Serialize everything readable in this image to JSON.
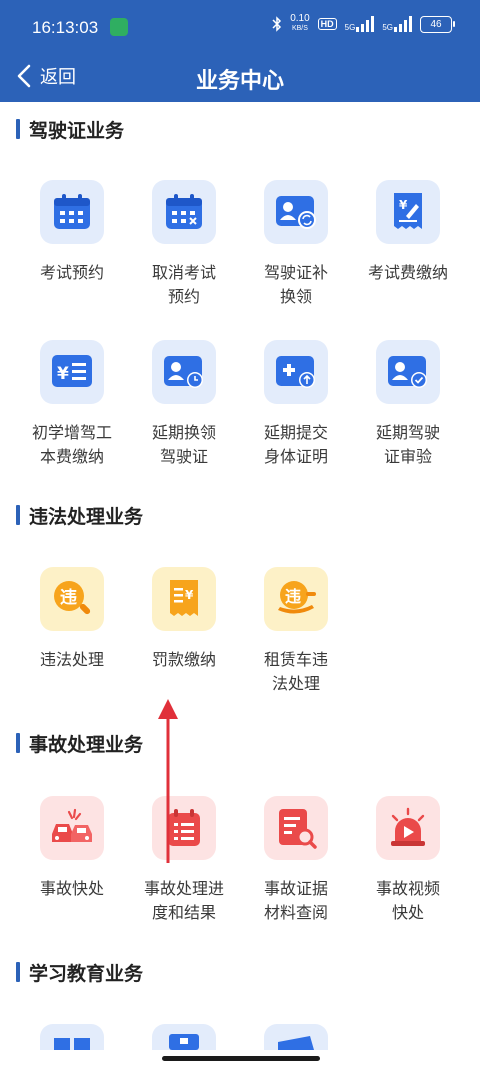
{
  "status": {
    "time": "16:13:03",
    "speed_value": "0.10",
    "speed_unit": "KB/S",
    "hd": "HD",
    "net1": "5G",
    "net2": "5G",
    "battery": "46"
  },
  "nav": {
    "back_label": "返回",
    "title": "业务中心"
  },
  "sections": [
    {
      "title": "驾驶证业务",
      "items": [
        {
          "label1": "考试预约",
          "label2": "",
          "icon": "calendar-grid-icon"
        },
        {
          "label1": "取消考试",
          "label2": "预约",
          "icon": "calendar-cancel-icon"
        },
        {
          "label1": "驾驶证补",
          "label2": "换领",
          "icon": "license-renew-icon"
        },
        {
          "label1": "考试费缴纳",
          "label2": "",
          "icon": "fee-receipt-icon"
        },
        {
          "label1": "初学增驾工",
          "label2": "本费缴纳",
          "icon": "yuan-list-icon"
        },
        {
          "label1": "延期换领",
          "label2": "驾驶证",
          "icon": "license-clock-icon"
        },
        {
          "label1": "延期提交",
          "label2": "身体证明",
          "icon": "medical-upload-icon"
        },
        {
          "label1": "延期驾驶",
          "label2": "证审验",
          "icon": "license-check-icon"
        }
      ]
    },
    {
      "title": "违法处理业务",
      "items": [
        {
          "label1": "违法处理",
          "label2": "",
          "icon": "violation-search-icon"
        },
        {
          "label1": "罚款缴纳",
          "label2": "",
          "icon": "fine-receipt-icon"
        },
        {
          "label1": "租赁车违",
          "label2": "法处理",
          "icon": "rental-violation-icon"
        }
      ]
    },
    {
      "title": "事故处理业务",
      "items": [
        {
          "label1": "事故快处",
          "label2": "",
          "icon": "car-crash-icon"
        },
        {
          "label1": "事故处理进",
          "label2": "度和结果",
          "icon": "accident-progress-icon"
        },
        {
          "label1": "事故证据",
          "label2": "材料查阅",
          "icon": "evidence-search-icon"
        },
        {
          "label1": "事故视频",
          "label2": "快处",
          "icon": "alarm-video-icon"
        }
      ]
    },
    {
      "title": "学习教育业务",
      "items": []
    }
  ],
  "colors": {
    "primary": "#2c62b8",
    "blue_tile": "#e3ecfb",
    "yellow_tile": "#fdf1c7",
    "red_tile": "#fde3e3",
    "arrow": "#e0303a"
  }
}
